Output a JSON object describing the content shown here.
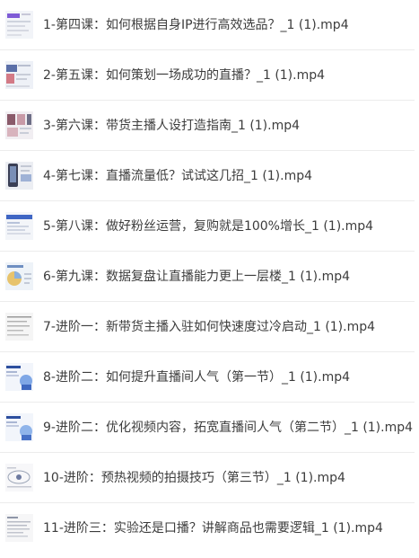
{
  "files": [
    {
      "name": "1-第四课：如何根据自身IP进行高效选品？_1 (1).mp4",
      "thumb_icon": "course-slide-thumbnail-icon"
    },
    {
      "name": "2-第五课：如何策划一场成功的直播？_1 (1).mp4",
      "thumb_icon": "course-slide-thumbnail-icon"
    },
    {
      "name": "3-第六课：带货主播人设打造指南_1 (1).mp4",
      "thumb_icon": "course-slide-thumbnail-icon"
    },
    {
      "name": "4-第七课：直播流量低？试试这几招_1 (1).mp4",
      "thumb_icon": "course-slide-thumbnail-icon"
    },
    {
      "name": "5-第八课：做好粉丝运营，复购就是100%增长_1 (1).mp4",
      "thumb_icon": "course-slide-thumbnail-icon"
    },
    {
      "name": "6-第九课：数据复盘让直播能力更上一层楼_1 (1).mp4",
      "thumb_icon": "course-slide-thumbnail-icon"
    },
    {
      "name": "7-进阶一：新带货主播入驻如何快速度过冷启动_1 (1).mp4",
      "thumb_icon": "course-slide-thumbnail-icon"
    },
    {
      "name": "8-进阶二：如何提升直播间人气（第一节）_1 (1).mp4",
      "thumb_icon": "course-slide-thumbnail-icon"
    },
    {
      "name": "9-进阶二：优化视频内容，拓宽直播间人气（第二节）_1 (1).mp4",
      "thumb_icon": "course-slide-thumbnail-icon"
    },
    {
      "name": "10-进阶：预热视频的拍摄技巧（第三节）_1 (1).mp4",
      "thumb_icon": "course-slide-thumbnail-icon"
    },
    {
      "name": "11-进阶三：实验还是口播？讲解商品也需要逻辑_1 (1).mp4",
      "thumb_icon": "course-slide-thumbnail-icon"
    }
  ]
}
